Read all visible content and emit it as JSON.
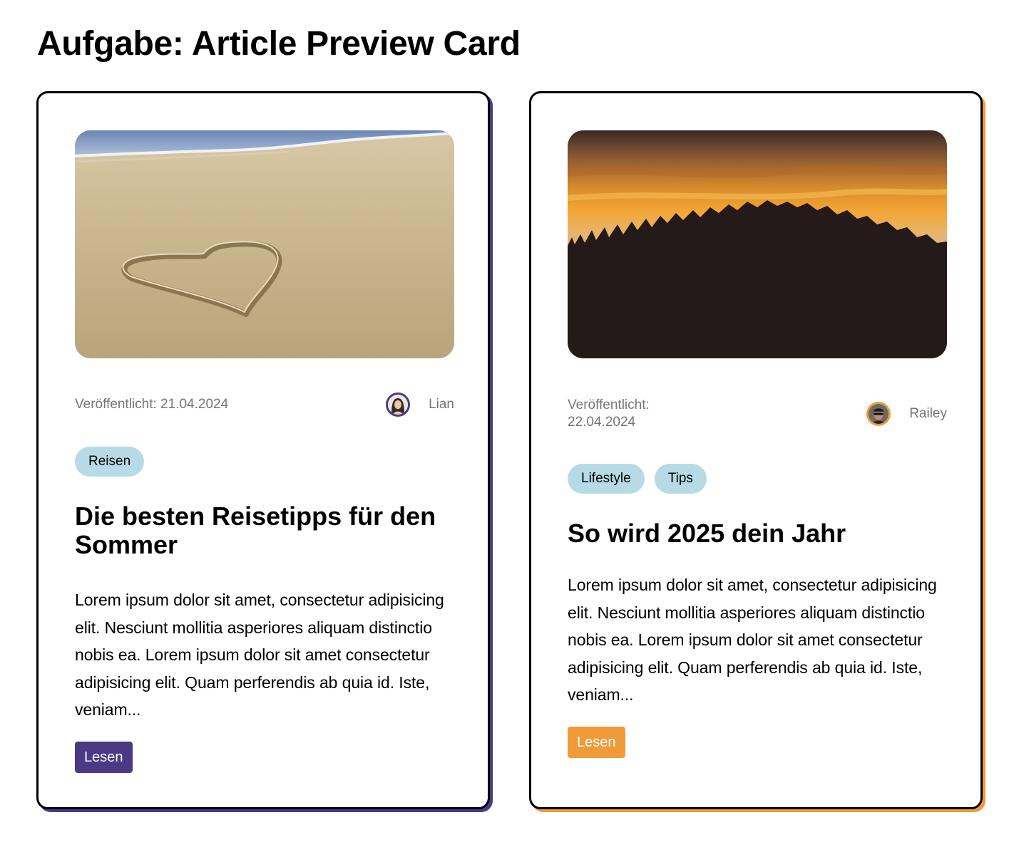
{
  "page": {
    "title": "Aufgabe: Article Preview Card"
  },
  "cards": [
    {
      "image_icon": "beach-heart-photo",
      "published": "Veröffentlicht: 21.04.2024",
      "author": "Lian",
      "tags": [
        "Reisen"
      ],
      "title": "Die besten Reisetipps für den Sommer",
      "body": "Lorem ipsum dolor sit amet, consectetur adipisicing elit. Nesciunt mollitia asperiores aliquam distinctio nobis ea. Lorem ipsum dolor sit amet consectetur adipisicing elit. Quam perferendis ab quia id. Iste, veniam...",
      "button": "Lesen",
      "accent": "#4a3a86"
    },
    {
      "image_icon": "sunset-hill-photo",
      "published": "Veröffentlicht: 22.04.2024",
      "author": "Railey",
      "tags": [
        "Lifestyle",
        "Tips"
      ],
      "title": "So wird 2025 dein Jahr",
      "body": "Lorem ipsum dolor sit amet, consectetur adipisicing elit. Nesciunt mollitia asperiores aliquam distinctio nobis ea. Lorem ipsum dolor sit amet consectetur adipisicing elit. Quam perferendis ab quia id. Iste, veniam...",
      "button": "Lesen",
      "accent": "#f09a39"
    }
  ]
}
